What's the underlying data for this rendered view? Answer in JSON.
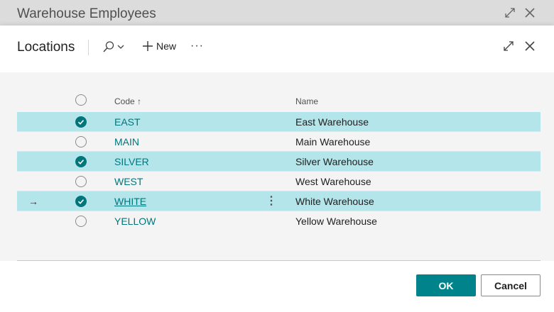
{
  "background_window": {
    "title": "Warehouse Employees"
  },
  "dialog": {
    "title": "Locations",
    "toolbar": {
      "search_icon": "search-icon",
      "new_label": "New",
      "more_label": "···"
    },
    "columns": {
      "code": "Code ↑",
      "name": "Name"
    },
    "rows": [
      {
        "code": "EAST",
        "name": "East Warehouse",
        "checked": true
      },
      {
        "code": "MAIN",
        "name": "Main Warehouse",
        "checked": false
      },
      {
        "code": "SILVER",
        "name": "Silver Warehouse",
        "checked": true
      },
      {
        "code": "WEST",
        "name": "West Warehouse",
        "checked": false
      },
      {
        "code": "WHITE",
        "name": "White Warehouse",
        "checked": true,
        "current": true
      },
      {
        "code": "YELLOW",
        "name": "Yellow Warehouse",
        "checked": false
      }
    ],
    "current_row_arrow": "→",
    "row_menu": "⋮",
    "buttons": {
      "ok": "OK",
      "cancel": "Cancel"
    }
  },
  "colors": {
    "accent": "#00767b",
    "selected_row": "#b3e5ea",
    "ok_button": "#00838a"
  }
}
